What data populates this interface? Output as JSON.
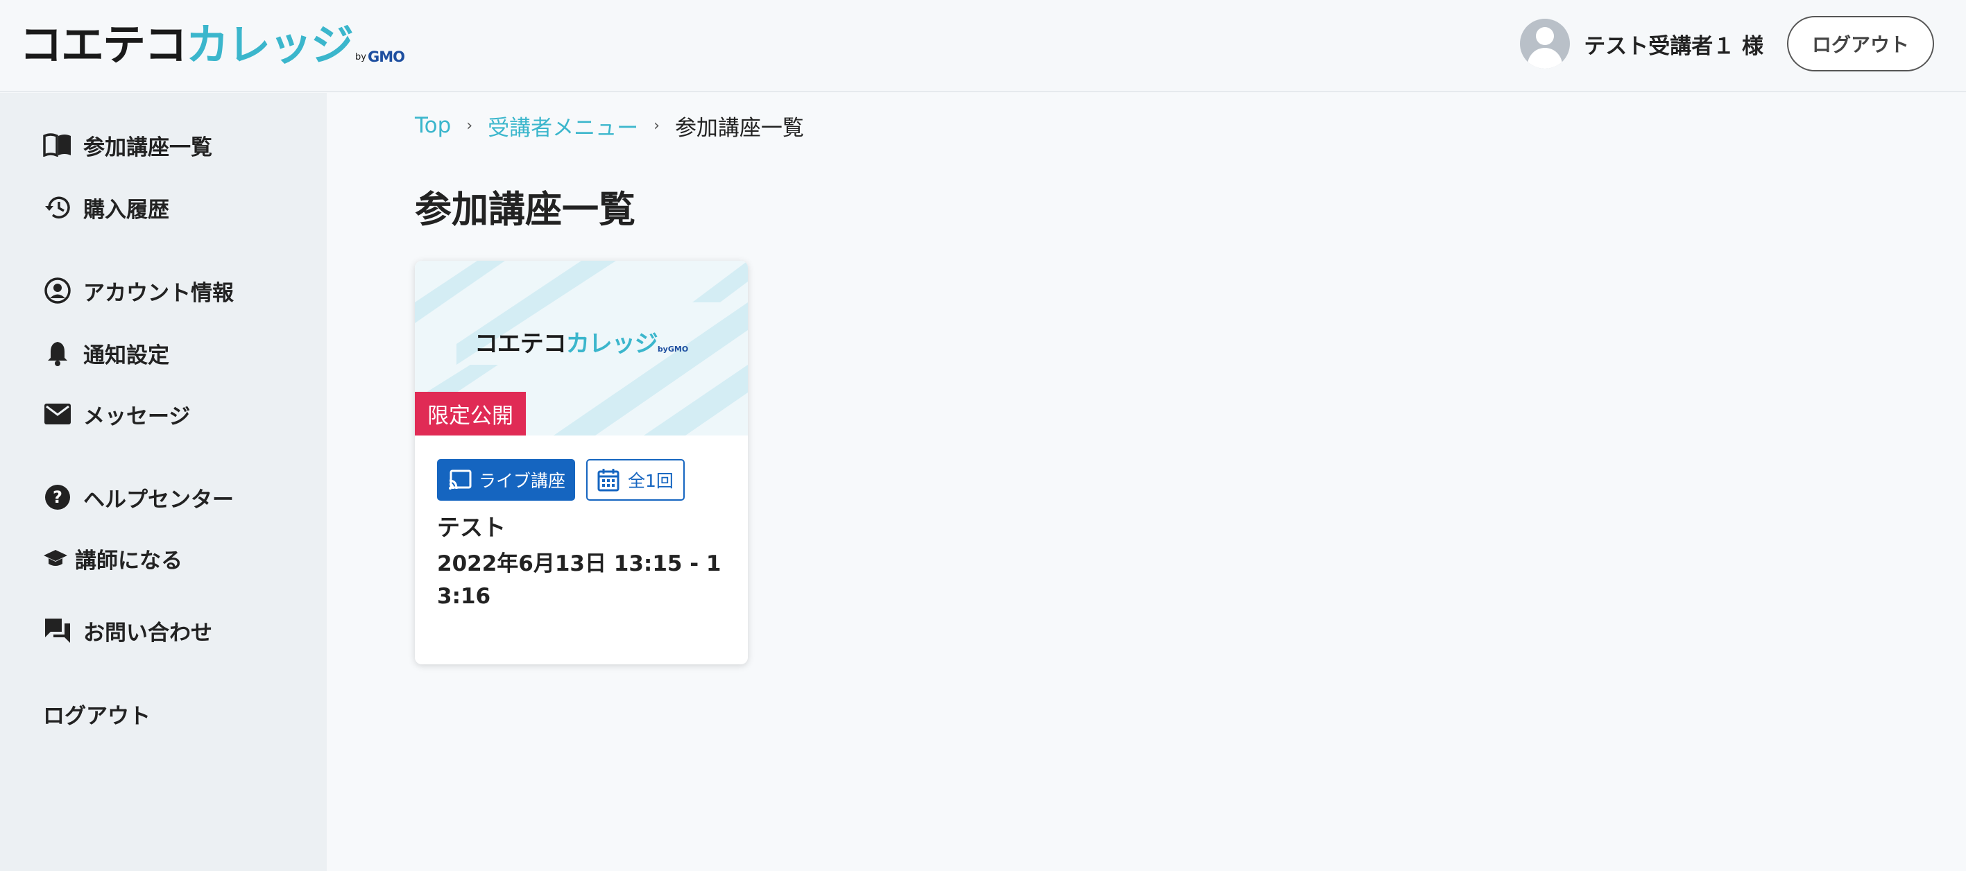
{
  "header": {
    "logo": {
      "part1": "コエテコ",
      "part2": "カレッジ",
      "by": "by",
      "gmo": "GMO"
    },
    "user_name": "テスト受講者１ 様",
    "logout_label": "ログアウト"
  },
  "sidebar": {
    "items": [
      {
        "label": "参加講座一覧",
        "icon": "book-open-icon"
      },
      {
        "label": "購入履歴",
        "icon": "history-icon"
      },
      {
        "label": "アカウント情報",
        "icon": "account-circle-icon"
      },
      {
        "label": "通知設定",
        "icon": "bell-icon"
      },
      {
        "label": "メッセージ",
        "icon": "envelope-icon"
      },
      {
        "label": "ヘルプセンター",
        "icon": "help-icon"
      },
      {
        "label": "講師になる",
        "icon": "graduation-cap-icon"
      },
      {
        "label": "お問い合わせ",
        "icon": "chat-icon"
      },
      {
        "label": "ログアウト"
      }
    ]
  },
  "breadcrumb": {
    "top": "Top",
    "menu": "受講者メニュー",
    "current": "参加講座一覧"
  },
  "page_title": "参加講座一覧",
  "card": {
    "thumbnail_logo": {
      "part1": "コエテコ",
      "part2": "カレッジ",
      "gmo": "byGMO"
    },
    "badge": "限定公開",
    "badge_color": "#e02b55",
    "tag_live": "ライブ講座",
    "tag_count": "全1回",
    "title": "テスト",
    "date": "2022年6月13日 13:15 - 13:16"
  },
  "colors": {
    "accent": "#3bb6cc",
    "primary": "#1565c0",
    "sidebar_bg": "#ecf0f3"
  }
}
